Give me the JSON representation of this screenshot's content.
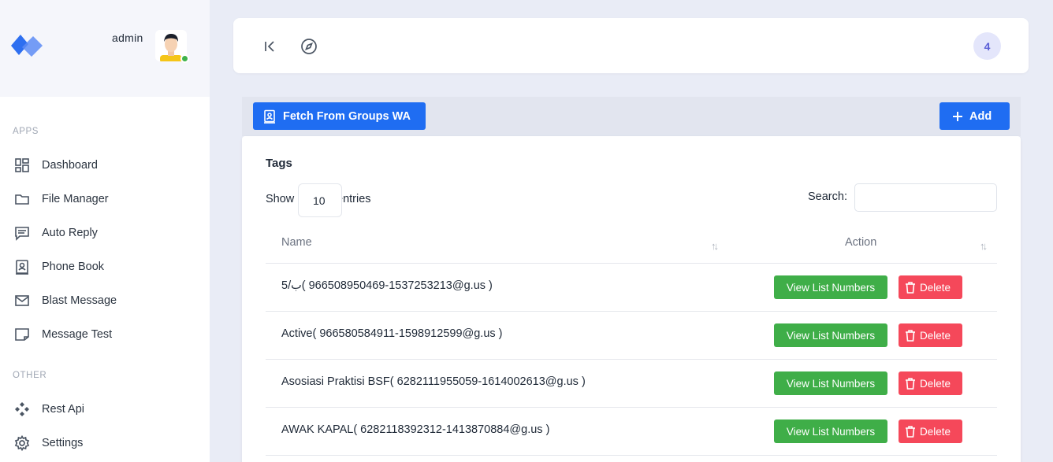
{
  "user": {
    "name": "admin"
  },
  "sidebar": {
    "sections": [
      {
        "label": "APPS"
      },
      {
        "label": "OTHER"
      }
    ],
    "items": [
      {
        "label": "Dashboard",
        "icon": "dashboard-icon"
      },
      {
        "label": "File Manager",
        "icon": "folder-icon"
      },
      {
        "label": "Auto Reply",
        "icon": "chat-icon"
      },
      {
        "label": "Phone Book",
        "icon": "contact-book-icon"
      },
      {
        "label": "Blast Message",
        "icon": "mail-icon"
      },
      {
        "label": "Message Test",
        "icon": "note-icon"
      },
      {
        "label": "Rest Api",
        "icon": "api-icon"
      },
      {
        "label": "Settings",
        "icon": "gear-icon"
      }
    ]
  },
  "header": {
    "badge_count": "4"
  },
  "toolbar": {
    "fetch_label": "Fetch From Groups WA",
    "add_label": "Add"
  },
  "card": {
    "title": "Tags",
    "show_label": "Show",
    "entries_label": "entries",
    "page_length": "10",
    "search_label": "Search:",
    "search_value": ""
  },
  "table": {
    "columns": [
      "Name",
      "Action"
    ],
    "rows": [
      {
        "name": "5/ب( 1537253213-966508950469@g.us )"
      },
      {
        "name": "Active( 966580584911-1598912599@g.us )"
      },
      {
        "name": "Asosiasi Praktisi BSF( 6282111955059-1614002613@g.us )"
      },
      {
        "name": "AWAK KAPAL( 6282118392312-1413870884@g.us )"
      }
    ],
    "view_label": "View List Numbers",
    "delete_label": "Delete"
  },
  "colors": {
    "primary": "#1f6df2",
    "success": "#3fae48",
    "danger": "#f5485a",
    "online": "#3fb24a"
  }
}
